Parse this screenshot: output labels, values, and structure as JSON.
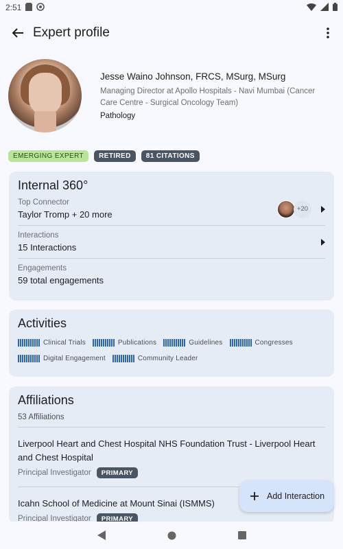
{
  "status_bar": {
    "time": "2:51"
  },
  "app_bar": {
    "title": "Expert profile"
  },
  "profile": {
    "name": "Jesse Waino Johnson, FRCS, MSurg, MSurg",
    "role": "Managing Director at Apollo Hospitals - Navi Mumbai (Cancer Care Centre - Surgical Oncology Team)",
    "specialty": "Pathology"
  },
  "badges": [
    "EMERGING EXPERT",
    "RETIRED",
    "81 CITATIONS"
  ],
  "internal360": {
    "title": "Internal 360°",
    "rows": [
      {
        "label": "Top Connector",
        "value": "Taylor Tromp + 20 more",
        "extra_count": "+20"
      },
      {
        "label": "Interactions",
        "value": "15 Interactions"
      },
      {
        "label": "Engagements",
        "value": "59 total engagements"
      }
    ]
  },
  "activities": {
    "title": "Activities",
    "items": [
      "Clinical Trials",
      "Publications",
      "Guidelines",
      "Congresses",
      "Digital Engagement",
      "Community Leader"
    ]
  },
  "affiliations": {
    "title": "Affiliations",
    "count": "53 Affiliations",
    "items": [
      {
        "name": "Liverpool Heart and Chest Hospital NHS Foundation Trust - Liverpool Heart and Chest Hospital",
        "position": "Principal Investigator",
        "badge": "PRIMARY"
      },
      {
        "name": "Icahn School of Medicine at Mount Sinai (ISMMS)",
        "position": "Principal Investigator",
        "badge": "PRIMARY"
      }
    ]
  },
  "fab": {
    "label": "Add Interaction"
  },
  "colors": {
    "accent": "#2b63b5",
    "card": "#e6ecf5",
    "badge_dark": "#4a5563",
    "badge_green": "#b9e59a",
    "fab": "#d6e4fa"
  }
}
